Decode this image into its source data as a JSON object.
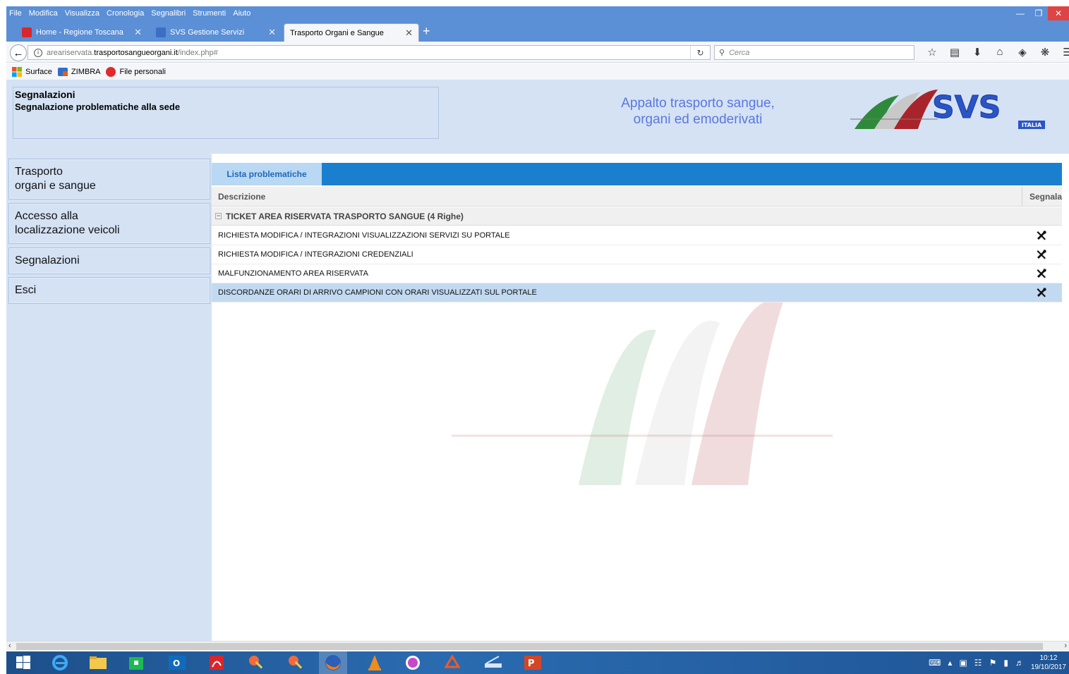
{
  "menubar": {
    "items": [
      "File",
      "Modifica",
      "Visualizza",
      "Cronologia",
      "Segnalibri",
      "Strumenti",
      "Aiuto"
    ]
  },
  "tabs": [
    {
      "label": "Home - Regione Toscana",
      "active": false,
      "favicon_color": "#d9262c"
    },
    {
      "label": "SVS Gestione Servizi",
      "active": false,
      "favicon_color": "#3a6fc2"
    },
    {
      "label": "Trasporto Organi e Sangue",
      "active": true,
      "favicon_color": ""
    }
  ],
  "nav": {
    "url_prefix": "areariservata.",
    "url_host": "trasportosangueorgani.it",
    "url_path": "/index.php#",
    "search_placeholder": "Cerca"
  },
  "bookmarks": [
    {
      "label": "Surface",
      "icon": "windows-icon"
    },
    {
      "label": "ZIMBRA",
      "icon": "zimbra-icon"
    },
    {
      "label": "File personali",
      "icon": "red-circle-icon"
    }
  ],
  "header": {
    "section_title": "Segnalazioni",
    "section_subtitle": "Segnalazione problematiche alla sede",
    "tagline_line1": "Appalto trasporto sangue,",
    "tagline_line2": "organi ed emoderivati",
    "logo_text": "SVS",
    "logo_sub": "ITALIA"
  },
  "sidebar": {
    "items": [
      {
        "line1": "Trasporto",
        "line2": "organi e sangue"
      },
      {
        "line1": "Accesso alla",
        "line2": "localizzazione veicoli"
      },
      {
        "line1": "Segnalazioni",
        "line2": ""
      },
      {
        "line1": "Esci",
        "line2": ""
      }
    ]
  },
  "list": {
    "tab_label": "Lista problematiche",
    "col_description": "Descrizione",
    "col_report": "Segnala",
    "group_label": "TICKET AREA RISERVATA TRASPORTO SANGUE (4 Righe)",
    "rows": [
      "RICHIESTA MODIFICA / INTEGRAZIONI VISUALIZZAZIONI SERVIZI SU PORTALE",
      "RICHIESTA MODIFICA / INTEGRAZIONI CREDENZIALI",
      "MALFUNZIONAMENTO AREA RISERVATA",
      "DISCORDANZE ORARI DI ARRIVO CAMPIONI CON ORARI VISUALIZZATI SUL PORTALE"
    ],
    "selected_row": 3
  },
  "taskbar": {
    "time": "10:12",
    "date": "19/10/2017"
  },
  "colors": {
    "accent": "#1b7fcf",
    "header_bg": "#d4e2f4",
    "tagline": "#5a77e0",
    "firefox_chrome": "#5b8fd6"
  }
}
